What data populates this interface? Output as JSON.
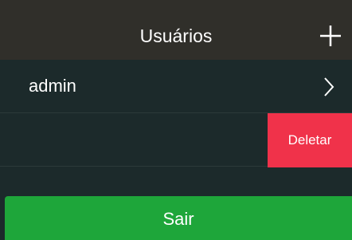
{
  "header": {
    "title": "Usuários",
    "add_icon": "plus-icon"
  },
  "users": [
    {
      "label": "admin",
      "icon": "chevron-right-icon"
    },
    {
      "label": ""
    }
  ],
  "swipe_action": {
    "label": "Deletar",
    "color": "#f0324a"
  },
  "footer": {
    "logout_label": "Sair",
    "color": "#1ea63a"
  },
  "colors": {
    "header_bg": "#302f2a",
    "list_bg": "#1c2a2b"
  }
}
